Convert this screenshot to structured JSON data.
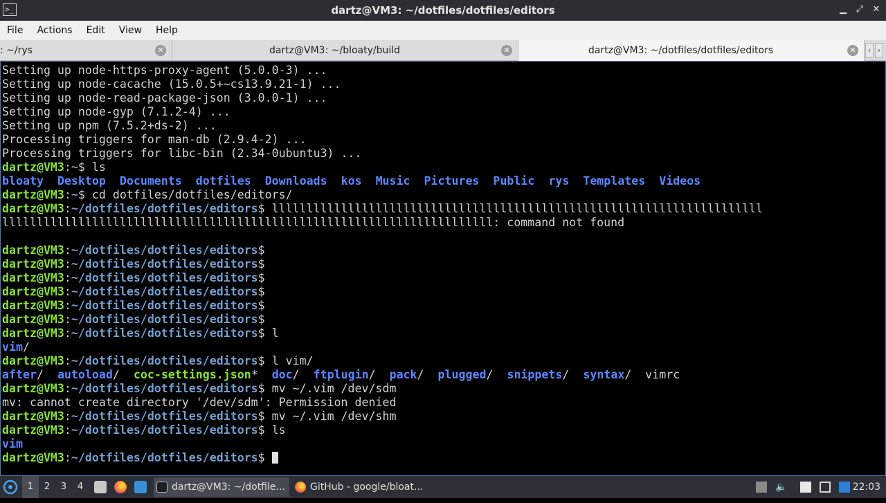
{
  "window": {
    "title": "dartz@VM3: ~/dotfiles/dotfiles/editors"
  },
  "menu": [
    "File",
    "Actions",
    "Edit",
    "View",
    "Help"
  ],
  "tabs": [
    {
      "label": ": ~/rys"
    },
    {
      "label": "dartz@VM3: ~/bloaty/build"
    },
    {
      "label": "dartz@VM3: ~/dotfiles/dotfiles/editors"
    }
  ],
  "terminal": {
    "lines": [
      [
        [
          "Setting up node-https-proxy-agent (5.0.0-3) ...",
          ""
        ]
      ],
      [
        [
          "Setting up node-cacache (15.0.5+~cs13.9.21-1) ...",
          ""
        ]
      ],
      [
        [
          "Setting up node-read-package-json (3.0.0-1) ...",
          ""
        ]
      ],
      [
        [
          "Setting up node-gyp (7.1.2-4) ...",
          ""
        ]
      ],
      [
        [
          "Setting up npm (7.5.2+ds-2) ...",
          ""
        ]
      ],
      [
        [
          "Processing triggers for man-db (2.9.4-2) ...",
          ""
        ]
      ],
      [
        [
          "Processing triggers for libc-bin (2.34-0ubuntu3) ...",
          ""
        ]
      ],
      [
        [
          "dartz@VM3",
          "u"
        ],
        [
          ":",
          ""
        ],
        [
          "~",
          "p"
        ],
        [
          "$ ls",
          ""
        ]
      ],
      [
        [
          "bloaty",
          "d"
        ],
        [
          "  ",
          ""
        ],
        [
          "Desktop",
          "d"
        ],
        [
          "  ",
          ""
        ],
        [
          "Documents",
          "d"
        ],
        [
          "  ",
          ""
        ],
        [
          "dotfiles",
          "d"
        ],
        [
          "  ",
          ""
        ],
        [
          "Downloads",
          "d"
        ],
        [
          "  ",
          ""
        ],
        [
          "kos",
          "d"
        ],
        [
          "  ",
          ""
        ],
        [
          "Music",
          "d"
        ],
        [
          "  ",
          ""
        ],
        [
          "Pictures",
          "d"
        ],
        [
          "  ",
          ""
        ],
        [
          "Public",
          "d"
        ],
        [
          "  ",
          ""
        ],
        [
          "rys",
          "d"
        ],
        [
          "  ",
          ""
        ],
        [
          "Templates",
          "d"
        ],
        [
          "  ",
          ""
        ],
        [
          "Videos",
          "d"
        ]
      ],
      [
        [
          "dartz@VM3",
          "u"
        ],
        [
          ":",
          ""
        ],
        [
          "~",
          "p"
        ],
        [
          "$ cd dotfiles/dotfiles/editors/",
          ""
        ]
      ],
      [
        [
          "dartz@VM3",
          "u"
        ],
        [
          ":",
          ""
        ],
        [
          "~/dotfiles/dotfiles/editors",
          "p"
        ],
        [
          "$ lllllllllllllllllllllllllllllllllllllllllllllllllllllllllllllllllllllll",
          ""
        ]
      ],
      [
        [
          "lllllllllllllllllllllllllllllllllllllllllllllllllllllllllllllllllllllll: command not found",
          ""
        ]
      ],
      [],
      [
        [
          "dartz@VM3",
          "u"
        ],
        [
          ":",
          ""
        ],
        [
          "~/dotfiles/dotfiles/editors",
          "p"
        ],
        [
          "$",
          ""
        ]
      ],
      [
        [
          "dartz@VM3",
          "u"
        ],
        [
          ":",
          ""
        ],
        [
          "~/dotfiles/dotfiles/editors",
          "p"
        ],
        [
          "$",
          ""
        ]
      ],
      [
        [
          "dartz@VM3",
          "u"
        ],
        [
          ":",
          ""
        ],
        [
          "~/dotfiles/dotfiles/editors",
          "p"
        ],
        [
          "$",
          ""
        ]
      ],
      [
        [
          "dartz@VM3",
          "u"
        ],
        [
          ":",
          ""
        ],
        [
          "~/dotfiles/dotfiles/editors",
          "p"
        ],
        [
          "$",
          ""
        ]
      ],
      [
        [
          "dartz@VM3",
          "u"
        ],
        [
          ":",
          ""
        ],
        [
          "~/dotfiles/dotfiles/editors",
          "p"
        ],
        [
          "$",
          ""
        ]
      ],
      [
        [
          "dartz@VM3",
          "u"
        ],
        [
          ":",
          ""
        ],
        [
          "~/dotfiles/dotfiles/editors",
          "p"
        ],
        [
          "$",
          ""
        ]
      ],
      [
        [
          "dartz@VM3",
          "u"
        ],
        [
          ":",
          ""
        ],
        [
          "~/dotfiles/dotfiles/editors",
          "p"
        ],
        [
          "$ l",
          ""
        ]
      ],
      [
        [
          "vim",
          "d"
        ],
        [
          "/",
          ""
        ]
      ],
      [
        [
          "dartz@VM3",
          "u"
        ],
        [
          ":",
          ""
        ],
        [
          "~/dotfiles/dotfiles/editors",
          "p"
        ],
        [
          "$ l vim/",
          ""
        ]
      ],
      [
        [
          "after",
          "d"
        ],
        [
          "/  ",
          ""
        ],
        [
          "autoload",
          "d"
        ],
        [
          "/  ",
          ""
        ],
        [
          "coc-settings.json",
          "u"
        ],
        [
          "*  ",
          ""
        ],
        [
          "doc",
          "d"
        ],
        [
          "/  ",
          ""
        ],
        [
          "ftplugin",
          "d"
        ],
        [
          "/  ",
          ""
        ],
        [
          "pack",
          "d"
        ],
        [
          "/  ",
          ""
        ],
        [
          "plugged",
          "d"
        ],
        [
          "/  ",
          ""
        ],
        [
          "snippets",
          "d"
        ],
        [
          "/  ",
          ""
        ],
        [
          "syntax",
          "d"
        ],
        [
          "/  vimrc",
          ""
        ]
      ],
      [
        [
          "dartz@VM3",
          "u"
        ],
        [
          ":",
          ""
        ],
        [
          "~/dotfiles/dotfiles/editors",
          "p"
        ],
        [
          "$ mv ~/.vim /dev/sdm",
          ""
        ]
      ],
      [
        [
          "mv: cannot create directory '/dev/sdm': Permission denied",
          ""
        ]
      ],
      [
        [
          "dartz@VM3",
          "u"
        ],
        [
          ":",
          ""
        ],
        [
          "~/dotfiles/dotfiles/editors",
          "p"
        ],
        [
          "$ mv ~/.vim /dev/shm",
          ""
        ]
      ],
      [
        [
          "dartz@VM3",
          "u"
        ],
        [
          ":",
          ""
        ],
        [
          "~/dotfiles/dotfiles/editors",
          "p"
        ],
        [
          "$ ls",
          ""
        ]
      ],
      [
        [
          "vim",
          "d"
        ]
      ],
      [
        [
          "dartz@VM3",
          "u"
        ],
        [
          ":",
          ""
        ],
        [
          "~/dotfiles/dotfiles/editors",
          "p"
        ],
        [
          "$ ",
          ""
        ]
      ]
    ]
  },
  "taskbar": {
    "workspaces": [
      "1",
      "2",
      "3",
      "4"
    ],
    "tasks": [
      {
        "label": "dartz@VM3: ~/dotfile..."
      },
      {
        "label": "GitHub - google/bloat..."
      }
    ],
    "clock": "22:03"
  },
  "colors": {
    "user": "#8ae234",
    "path": "#729fcf",
    "dir": "#5c86ff",
    "terminal_bg": "#000000"
  },
  "icons": [
    "terminal-icon",
    "minimize-icon",
    "maximize-icon",
    "close-icon",
    "start-menu-icon",
    "file-manager-icon",
    "firefox-icon",
    "desktop-icon",
    "tray-up-icon",
    "volume-icon",
    "clipboard-icon",
    "network-icon",
    "notification-icon"
  ]
}
